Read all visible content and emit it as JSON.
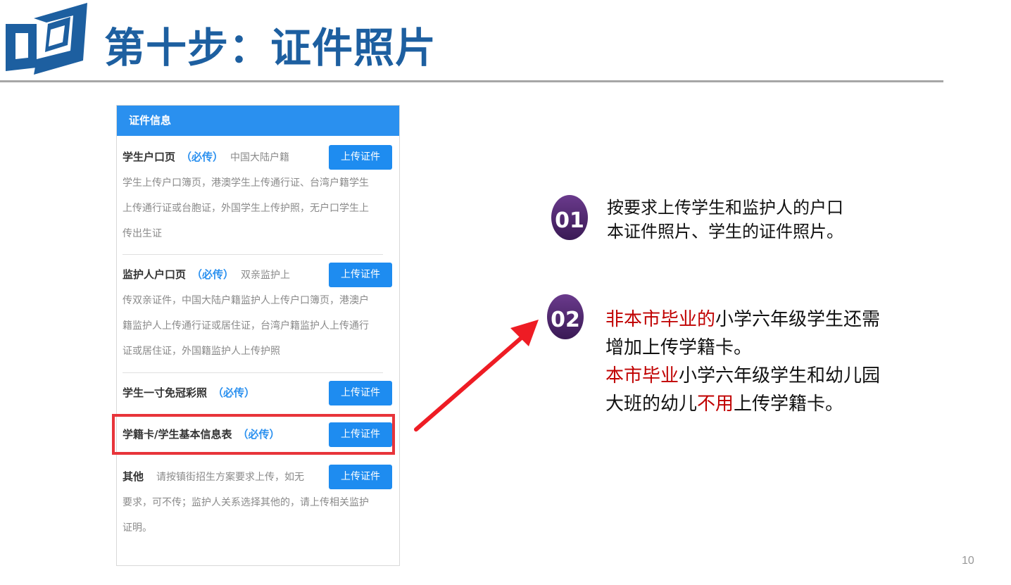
{
  "slide": {
    "title": "第十步：证件照片",
    "page_number": "10"
  },
  "panel": {
    "header": "证件信息",
    "upload_label": "上传证件",
    "items": [
      {
        "name": "学生户口页",
        "required": "（必传）",
        "first_desc": "中国大陆户籍",
        "desc_lines": [
          "学生上传户口簿页，港澳学生上传通行证、台湾户籍学生",
          "上传通行证或台胞证，外国学生上传护照，无户口学生上",
          "传出生证"
        ]
      },
      {
        "name": "监护人户口页",
        "required": "（必传）",
        "first_desc": "双亲监护上",
        "desc_lines": [
          "传双亲证件，中国大陆户籍监护人上传户口簿页，港澳户",
          "籍监护人上传通行证或居住证，台湾户籍监护人上传通行",
          "证或居住证，外国籍监护人上传护照"
        ]
      },
      {
        "name": "学生一寸免冠彩照",
        "required": "（必传）"
      },
      {
        "name": "学籍卡/学生基本信息表",
        "required": "（必传）"
      },
      {
        "name": "其他",
        "first_desc": "请按镇街招生方案要求上传，如无",
        "desc_lines": [
          "要求，可不传；监护人关系选择其他的，请上传相关监护",
          "证明。"
        ]
      }
    ]
  },
  "notes": {
    "note1": {
      "badge": "01",
      "line1": "按要求上传学生和监护人的户口",
      "line2": "本证件照片、学生的证件照片。"
    },
    "note2": {
      "badge": "02",
      "line1_red": "非本市毕业的",
      "line1_black": "小学六年级学生还需",
      "line2": "增加上传学籍卡。",
      "line3_red": "本市毕业",
      "line3_black": "小学六年级学生和幼儿园",
      "line4_black": "大班的幼儿",
      "line4_red": "不用",
      "line4_end": "上传学籍卡。"
    }
  },
  "colors": {
    "title": "#1d5fa0",
    "header_bg": "#2a90ef",
    "button_bg": "#1e8cf0",
    "required": "#2a90ef",
    "highlight": "#e8343a",
    "emphasis_red": "#c00000",
    "badge_fill": "#4a2565"
  },
  "icons": {
    "logo": "book-logo-icon",
    "arrow": "red-arrow-icon"
  }
}
